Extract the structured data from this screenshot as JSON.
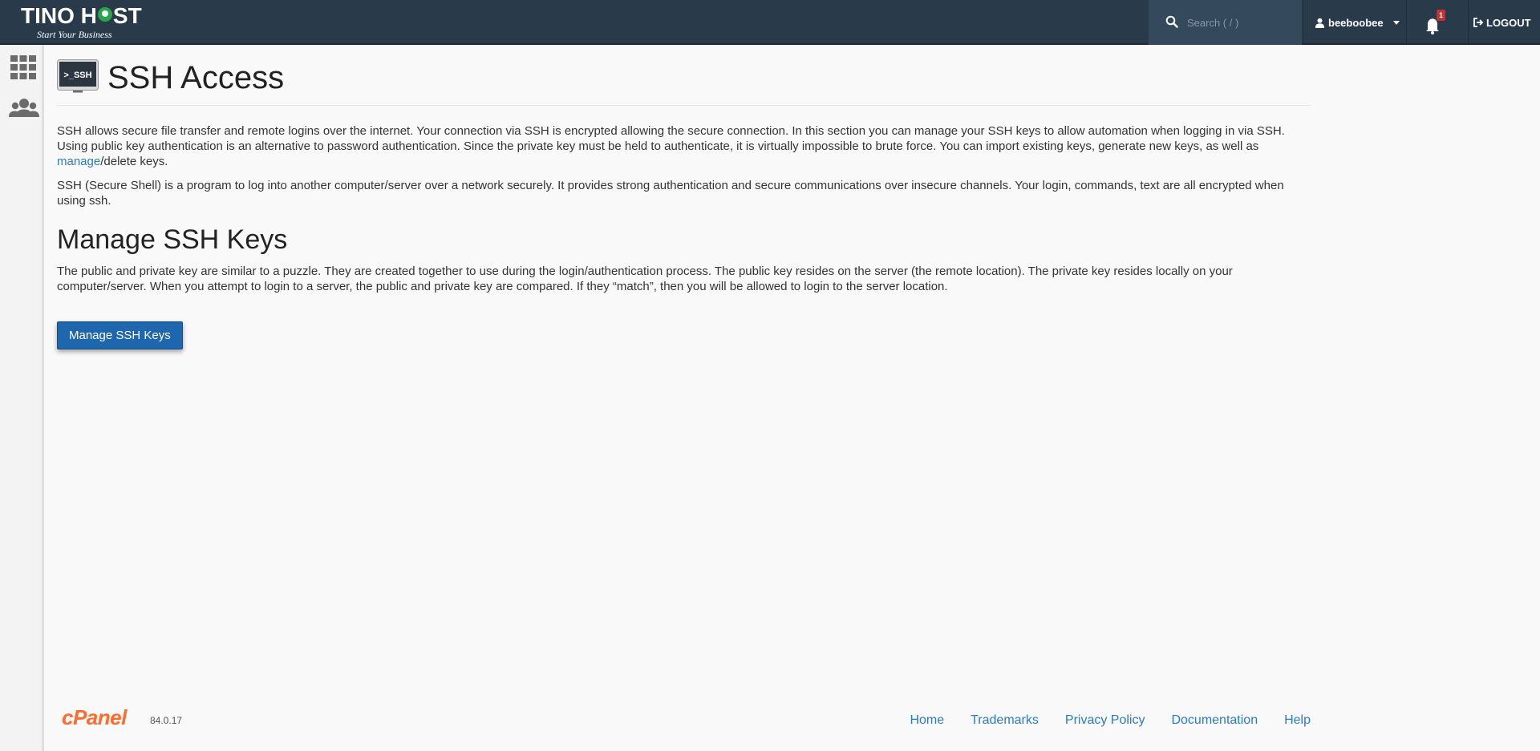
{
  "header": {
    "brand_name_left": "TINO H",
    "brand_name_right": "ST",
    "brand_tagline": "Start Your Business",
    "search_placeholder": "Search ( / )",
    "username": "beeboobee",
    "notification_count": "1",
    "logout_label": "LOGOUT"
  },
  "sidebar": {
    "items": [
      {
        "icon": "grid-icon"
      },
      {
        "icon": "users-icon"
      }
    ]
  },
  "main": {
    "ssh_icon_text": ">_SSH",
    "page_title": "SSH Access",
    "intro_part1": "SSH allows secure file transfer and remote logins over the internet. Your connection via SSH is encrypted allowing the secure connection. In this section you can manage your SSH keys to allow automation when logging in via SSH. Using public key authentication is an alternative to password authentication. Since the private key must be held to authenticate, it is virtually impossible to brute force. You can import existing keys, generate new keys, as well as ",
    "intro_link": "manage",
    "intro_part2": "/delete keys.",
    "intro_2": "SSH (Secure Shell) is a program to log into another computer/server over a network securely. It provides strong authentication and secure communications over insecure channels. Your login, commands, text are all encrypted when using ssh.",
    "section_title": "Manage SSH Keys",
    "section_desc": "The public and private key are similar to a puzzle. They are created together to use during the login/authentication process. The public key resides on the server (the remote location). The private key resides locally on your computer/server. When you attempt to login to a server, the public and private key are compared. If they “match”, then you will be allowed to login to the server location.",
    "button_label": "Manage SSH Keys"
  },
  "footer": {
    "logo_text": "cPanel",
    "version": "84.0.17",
    "links": [
      "Home",
      "Trademarks",
      "Privacy Policy",
      "Documentation",
      "Help"
    ]
  },
  "colors": {
    "header_bg": "#293a4a",
    "link": "#2a7bc2",
    "button_bg": "#1e66ad",
    "cpanel_orange": "#ff6c2c"
  }
}
